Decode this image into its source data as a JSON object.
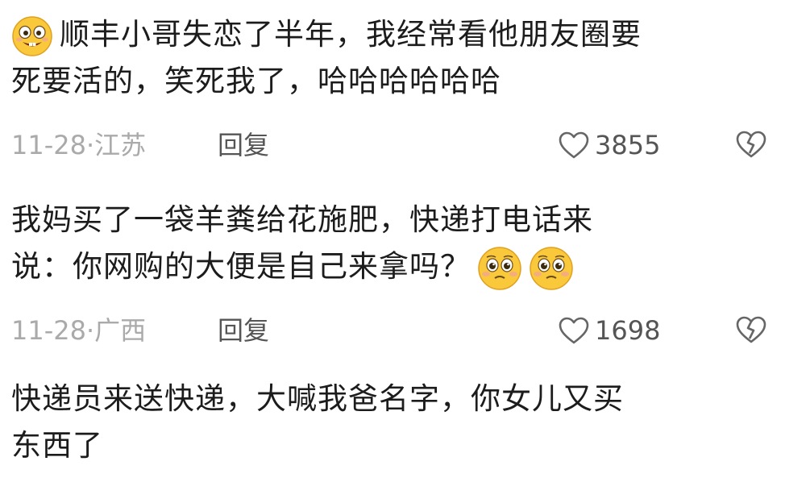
{
  "comments": [
    {
      "lines": [
        "顺丰小哥失恋了半年，我经常看他朋友圈要",
        "死要活的，笑死我了，哈哈哈哈哈哈"
      ],
      "lead_emoji": "grinning-face-emoji",
      "date": "11-28·江苏",
      "reply_label": "回复",
      "likes": "3855"
    },
    {
      "lines": [
        "我妈买了一袋羊粪给花施肥，快递打电话来",
        "说：你网购的大便是自己来拿吗？"
      ],
      "trailing_emojis": [
        "pleading-face-emoji",
        "pleading-face-emoji"
      ],
      "date": "11-28·广西",
      "reply_label": "回复",
      "likes": "1698"
    },
    {
      "lines": [
        "快递员来送快递，大喊我爸名字，你女儿又买",
        "东西了"
      ]
    }
  ],
  "icons": {
    "like": "heart-outline-icon",
    "dislike": "broken-heart-icon"
  },
  "colors": {
    "text": "#1c1c1c",
    "meta": "#aaaaaa",
    "action": "#555555",
    "emoji_face": "#f9c93b"
  }
}
